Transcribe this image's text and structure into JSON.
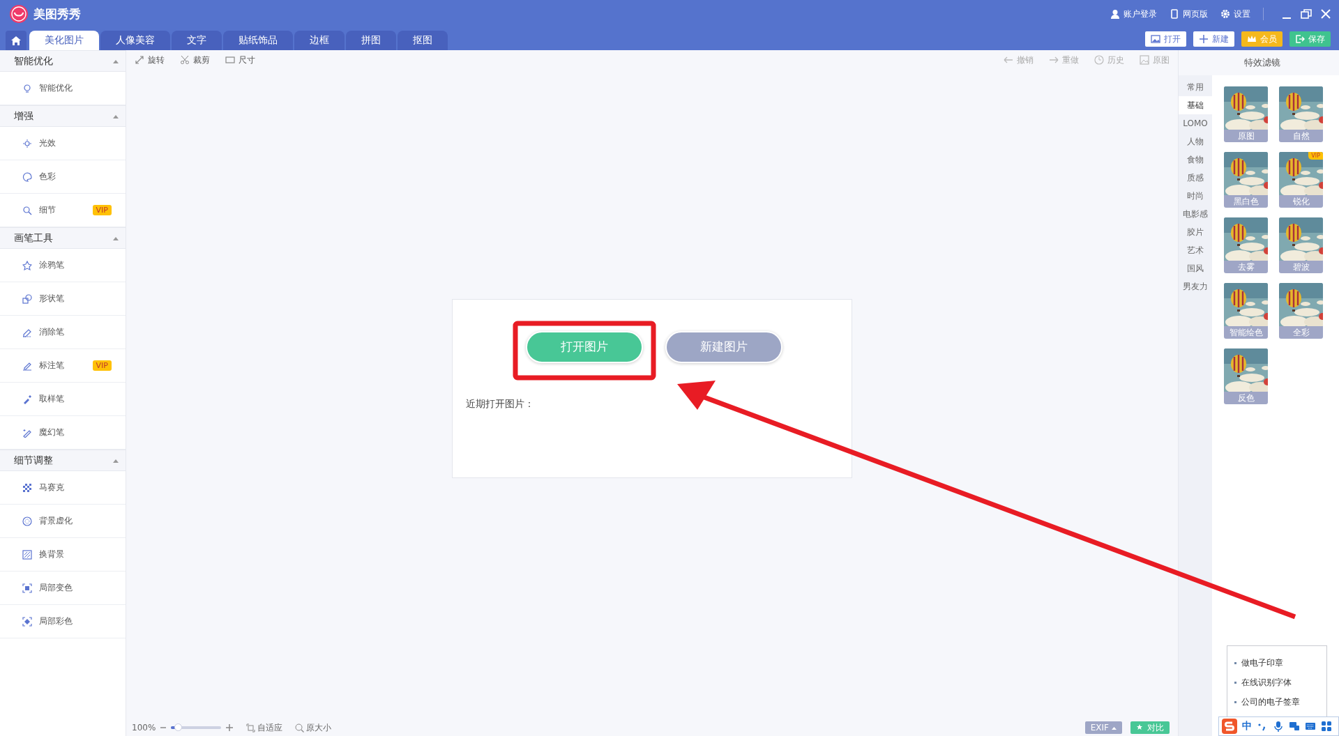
{
  "app": {
    "title": "美图秀秀"
  },
  "top_links": [
    {
      "label": "账户登录"
    },
    {
      "label": "网页版"
    },
    {
      "label": "设置"
    }
  ],
  "tabs": [
    {
      "label": "美化图片",
      "selected": true
    },
    {
      "label": "人像美容",
      "selected": false
    },
    {
      "label": "文字",
      "selected": false
    },
    {
      "label": "贴纸饰品",
      "selected": false
    },
    {
      "label": "边框",
      "selected": false
    },
    {
      "label": "拼图",
      "selected": false
    },
    {
      "label": "抠图",
      "selected": false
    }
  ],
  "actions": [
    {
      "label": "打开",
      "kind": "open"
    },
    {
      "label": "新建",
      "kind": "new"
    },
    {
      "label": "会员",
      "kind": "vip"
    },
    {
      "label": "保存",
      "kind": "save"
    }
  ],
  "sidebar": {
    "sections": [
      {
        "title": "智能优化",
        "expanded": true,
        "items": [
          {
            "label": "智能优化"
          }
        ]
      },
      {
        "title": "增强",
        "expanded": true,
        "items": [
          {
            "label": "光效"
          },
          {
            "label": "色彩"
          },
          {
            "label": "细节",
            "badge": "VIP"
          }
        ]
      },
      {
        "title": "画笔工具",
        "expanded": true,
        "items": [
          {
            "label": "涂鸦笔"
          },
          {
            "label": "形状笔"
          },
          {
            "label": "消除笔"
          },
          {
            "label": "标注笔",
            "badge": "VIP"
          },
          {
            "label": "取样笔"
          },
          {
            "label": "魔幻笔"
          }
        ]
      },
      {
        "title": "细节调整",
        "expanded": true,
        "items": [
          {
            "label": "马赛克"
          },
          {
            "label": "背景虚化"
          },
          {
            "label": "换背景"
          },
          {
            "label": "局部变色"
          },
          {
            "label": "局部彩色"
          }
        ]
      }
    ]
  },
  "toolbar": {
    "left": [
      {
        "label": "旋转",
        "disabled": false
      },
      {
        "label": "裁剪",
        "disabled": false
      },
      {
        "label": "尺寸",
        "disabled": false
      }
    ],
    "right": [
      {
        "label": "撤销",
        "disabled": true
      },
      {
        "label": "重做",
        "disabled": true
      },
      {
        "label": "历史",
        "disabled": true
      },
      {
        "label": "原图",
        "disabled": true
      }
    ]
  },
  "start_card": {
    "buttons": [
      {
        "label": "打开图片",
        "kind": "primary"
      },
      {
        "label": "新建图片",
        "kind": "secondary"
      }
    ],
    "recent_label": "近期打开图片："
  },
  "zoom_bar": {
    "percent": "100%",
    "level": 0.15,
    "fit": "自适应",
    "actual": "原大小"
  },
  "bottom_buttons": [
    {
      "label": "EXIF",
      "kind": "menu"
    },
    {
      "label": "对比",
      "kind": "compare"
    }
  ],
  "filter_panel": {
    "title": "特效滤镜",
    "categories": [
      {
        "label": "常用",
        "selected": false
      },
      {
        "label": "基础",
        "selected": true
      },
      {
        "label": "LOMO",
        "selected": false
      },
      {
        "label": "人物",
        "selected": false
      },
      {
        "label": "食物",
        "selected": false
      },
      {
        "label": "质感",
        "selected": false
      },
      {
        "label": "时尚",
        "selected": false
      },
      {
        "label": "电影感",
        "selected": false
      },
      {
        "label": "胶片",
        "selected": false
      },
      {
        "label": "艺术",
        "selected": false
      },
      {
        "label": "国风",
        "selected": false
      },
      {
        "label": "男友力",
        "selected": false
      }
    ],
    "filters": [
      {
        "label": "原图"
      },
      {
        "label": "自然"
      },
      {
        "label": "黑白色"
      },
      {
        "label": "锐化",
        "badge": "VIP"
      },
      {
        "label": "去雾"
      },
      {
        "label": "碧波"
      },
      {
        "label": "智能绘色"
      },
      {
        "label": "全彩"
      },
      {
        "label": "反色"
      }
    ]
  },
  "popup": {
    "items": [
      "做电子印章",
      "在线识别字体",
      "公司的电子签章"
    ]
  },
  "ime_bar": {
    "mode": "中"
  },
  "annotations": {
    "highlight_box": true,
    "arrow": true
  }
}
